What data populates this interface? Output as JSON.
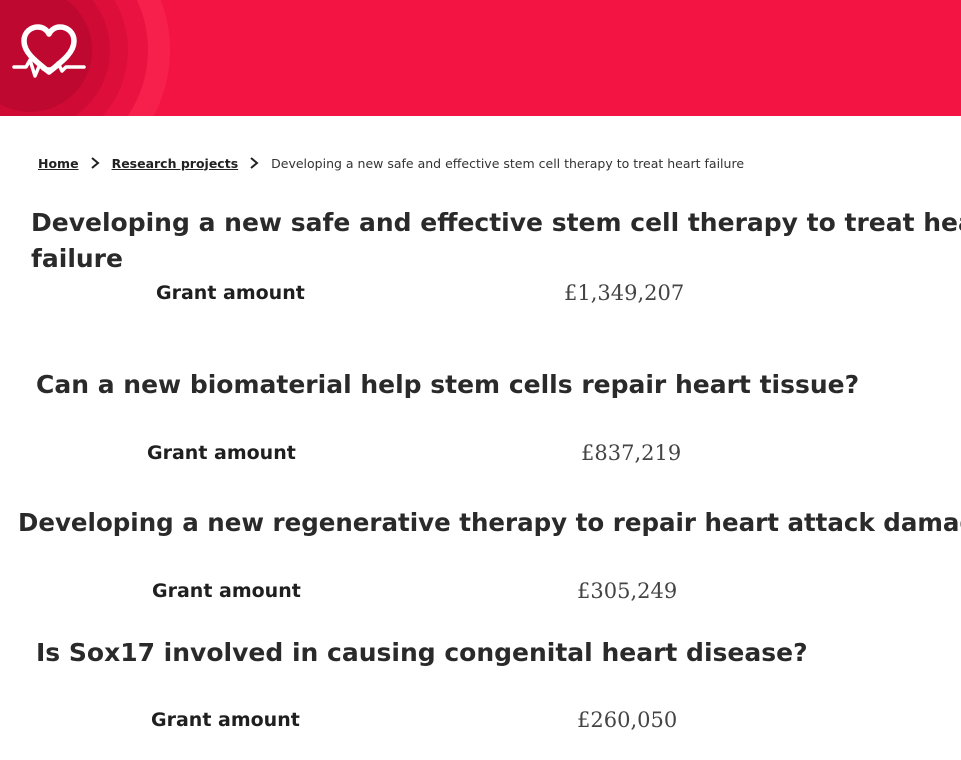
{
  "brand": {
    "logo_icon": "heart-beat-logo-icon",
    "accent_color": "#f41443"
  },
  "breadcrumb": {
    "home": "Home",
    "research": "Research projects",
    "current": "Developing a new safe and effective stem cell therapy to treat heart failure"
  },
  "projects": [
    {
      "title_line1": "Developing a new safe and effective stem cell therapy to treat heart",
      "title_line2": "failure",
      "grant_label": "Grant amount",
      "grant_value": "£1,349,207"
    },
    {
      "title": "Can a new biomaterial help stem cells repair heart tissue?",
      "grant_label": "Grant amount",
      "grant_value": "£837,219"
    },
    {
      "title": "Developing a new regenerative therapy to repair heart attack damage",
      "grant_label": "Grant amount",
      "grant_value": "£305,249"
    },
    {
      "title": "Is Sox17 involved in causing congenital heart disease?",
      "grant_label": "Grant amount",
      "grant_value": "£260,050"
    }
  ]
}
